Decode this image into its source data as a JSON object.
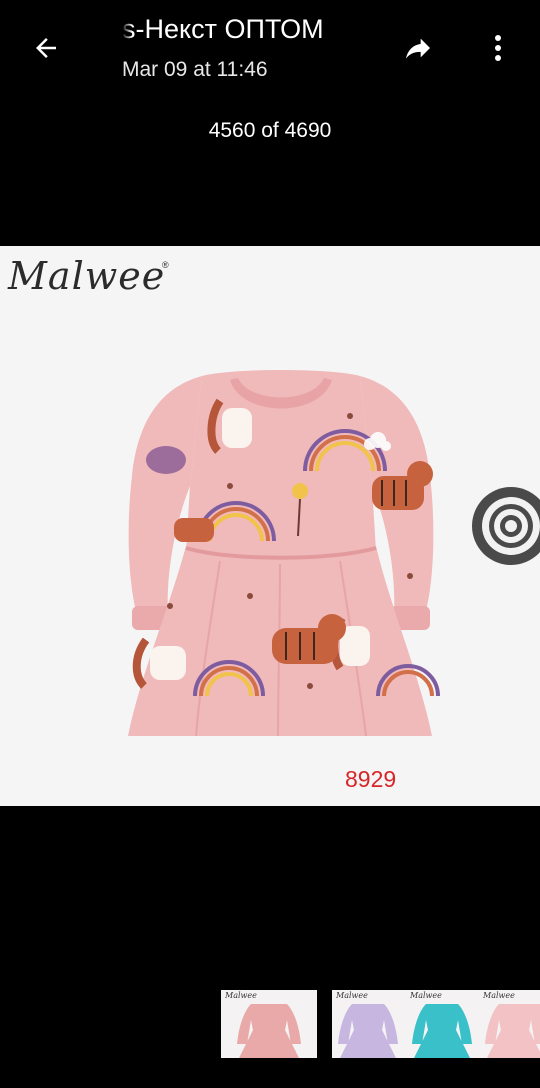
{
  "header": {
    "title": "s-Некст ОПТОМ",
    "subtitle": "Mar 09 at 11:46",
    "counter": "4560 of 4690"
  },
  "icons": {
    "back": "arrow-left-icon",
    "share": "share-arrow-icon",
    "menu": "more-vertical-icon",
    "lens": "lens-target-icon"
  },
  "photo": {
    "brand": "Malwee",
    "brand_mark": "®",
    "article_number": "8929"
  },
  "thumbnails": [
    {
      "label": "Malwee",
      "dress_color": "#e9a9a9",
      "bg": "#f4f2f2"
    },
    {
      "label": "Malwee",
      "dress_color": "#c7b7e0",
      "bg": "#f4f2f2"
    },
    {
      "label": "Malwee",
      "dress_color": "#39c0c8",
      "bg": "#f4f2f2"
    },
    {
      "label": "Malwee",
      "dress_color": "#f2c2c4",
      "bg": "#f4f2f2"
    }
  ],
  "colors": {
    "background": "#000000",
    "dress_pink": "#f0b9ba",
    "article_red": "#d6262a"
  }
}
